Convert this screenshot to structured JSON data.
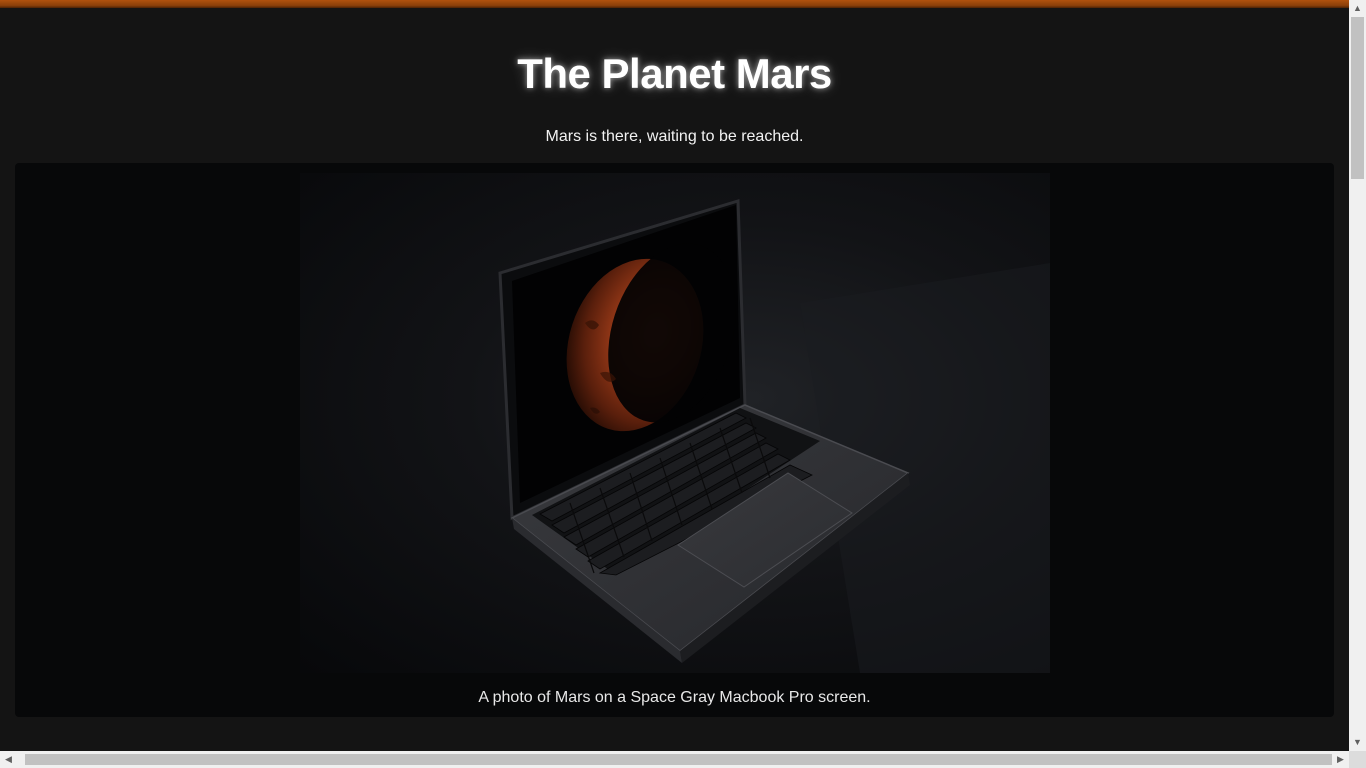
{
  "page": {
    "title": "The Planet Mars",
    "subtitle": "Mars is there, waiting to be reached."
  },
  "figure": {
    "image_description_alt": "A photo of Mars on a Space Gray Macbook Pro screen.",
    "caption": "A photo of Mars on a Space Gray Macbook Pro screen."
  },
  "colors": {
    "background": "#141414",
    "accent_top_border": "#b0520e",
    "figure_background": "#070809",
    "text": "#ffffff"
  },
  "icons": {
    "scroll_up": "triangle-up-icon",
    "scroll_down": "triangle-down-icon",
    "scroll_left": "triangle-left-icon",
    "scroll_right": "triangle-right-icon"
  }
}
